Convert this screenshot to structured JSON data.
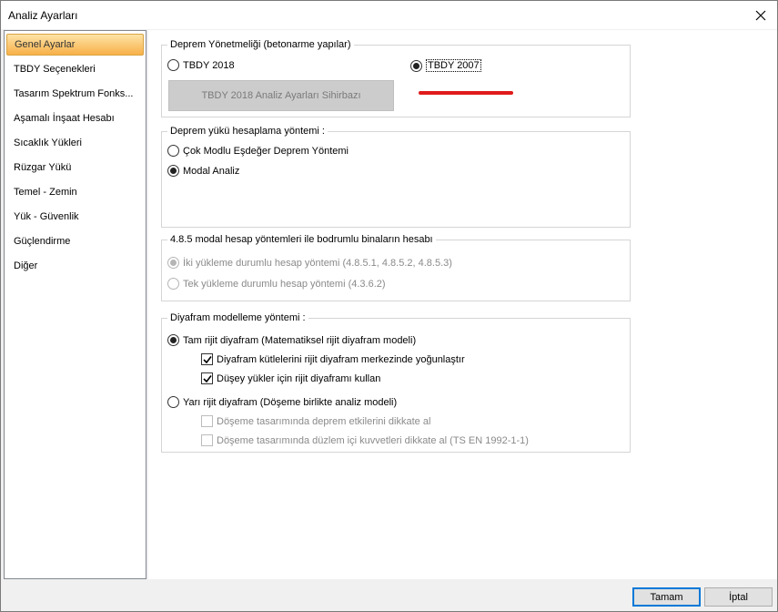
{
  "window": {
    "title": "Analiz Ayarları"
  },
  "sidebar": {
    "items": [
      {
        "label": "Genel Ayarlar",
        "active": true
      },
      {
        "label": "TBDY Seçenekleri"
      },
      {
        "label": "Tasarım Spektrum Fonks..."
      },
      {
        "label": "Aşamalı İnşaat Hesabı"
      },
      {
        "label": "Sıcaklık Yükleri"
      },
      {
        "label": "Rüzgar Yükü"
      },
      {
        "label": "Temel - Zemin"
      },
      {
        "label": "Yük - Güvenlik"
      },
      {
        "label": "Güçlendirme"
      },
      {
        "label": "Diğer"
      }
    ]
  },
  "deprem_yonetmeligi": {
    "legend": "Deprem Yönetmeliği (betonarme yapılar)",
    "tbdy2018": "TBDY 2018",
    "tbdy2007": "TBDY 2007",
    "wizard_button": "TBDY 2018 Analiz Ayarları Sihirbazı",
    "selected": "TBDY 2007"
  },
  "deprem_yuku": {
    "legend": "Deprem yükü hesaplama yöntemi :",
    "option1": "Çok Modlu Eşdeğer Deprem Yöntemi",
    "option2": "Modal Analiz",
    "selected": "Modal Analiz"
  },
  "bodrum": {
    "legend": "4.8.5 modal hesap yöntemleri ile bodrumlu binaların hesabı",
    "option1": "İki yükleme durumlu hesap yöntemi (4.8.5.1, 4.8.5.2, 4.8.5.3)",
    "option2": "Tek yükleme durumlu hesap yöntemi (4.3.6.2)"
  },
  "diyafram": {
    "legend": "Diyafram modelleme yöntemi  :",
    "tam_rijit": "Tam rijit diyafram (Matematiksel rijit diyafram modeli)",
    "tam_check1": "Diyafram kütlelerini rijit diyafram merkezinde yoğunlaştır",
    "tam_check2": "Düşey yükler için rijit diyaframı kullan",
    "yari_rijit": "Yarı rijit diyafram (Döşeme birlikte analiz modeli)",
    "yari_check1": "Döşeme tasarımında deprem etkilerini dikkate al",
    "yari_check2": "Döşeme tasarımında düzlem içi kuvvetleri dikkate al (TS EN 1992-1-1)"
  },
  "footer": {
    "ok": "Tamam",
    "cancel": "İptal"
  },
  "colors": {
    "active_item_top": "#fde3a7",
    "active_item_bottom": "#f8b048",
    "annotation_red": "#e01b1b"
  }
}
